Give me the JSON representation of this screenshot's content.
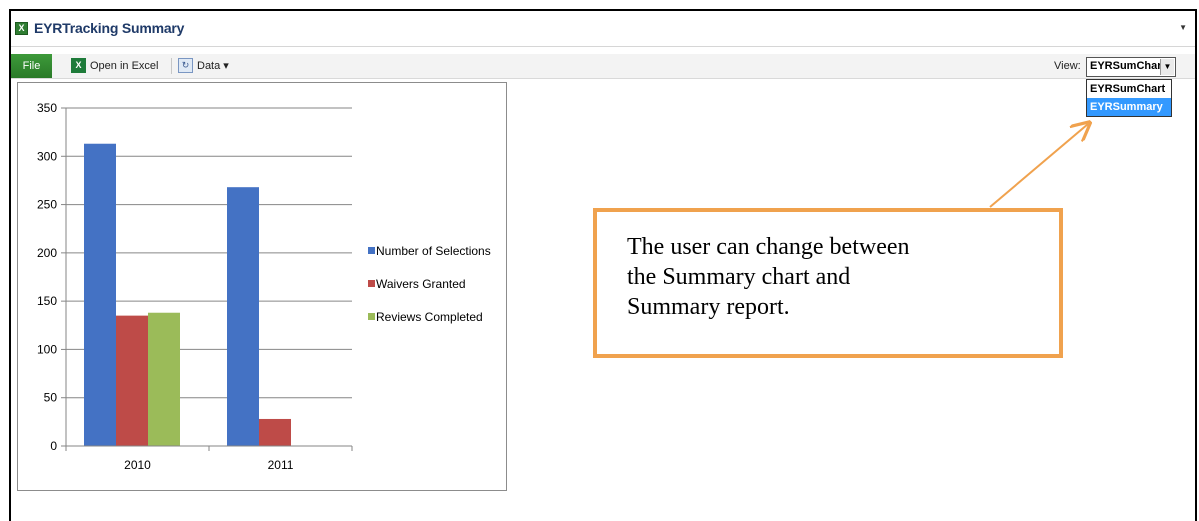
{
  "window": {
    "title": "EYRTracking Summary"
  },
  "ribbon": {
    "file_label": "File",
    "open_excel_label": "Open in Excel",
    "data_label": "Data ▾",
    "view_label": "View:",
    "view_selected": "EYRSumChart",
    "view_options": [
      "EYRSumChart",
      "EYRSummary"
    ],
    "highlighted_option": "EYRSummary"
  },
  "callout": {
    "line1": "The user can change between",
    "line2": "the Summary chart and",
    "line3": "Summary report."
  },
  "colors": {
    "accent_green": "#2f8a2d",
    "callout_border": "#f0a24e",
    "selection_blue": "#3399ff"
  },
  "chart_data": {
    "type": "bar",
    "categories": [
      "2010",
      "2011"
    ],
    "series": [
      {
        "name": "Number of Selections",
        "values": [
          313,
          268
        ],
        "color": "#4472c4"
      },
      {
        "name": "Waivers Granted",
        "values": [
          135,
          28
        ],
        "color": "#be4b48"
      },
      {
        "name": "Reviews Completed",
        "values": [
          138,
          null
        ],
        "color": "#9bbb59"
      }
    ],
    "yticks": [
      "0",
      "50",
      "100",
      "150",
      "200",
      "250",
      "300",
      "350"
    ],
    "ylim": [
      0,
      350
    ],
    "grid": true,
    "legend": "right"
  }
}
